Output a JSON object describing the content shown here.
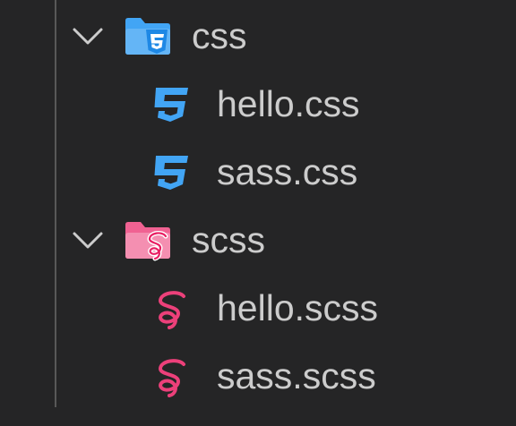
{
  "explorer": {
    "folders": [
      {
        "name": "css",
        "expanded": true,
        "icon": "css-folder-icon",
        "icon_color": "#42a5f5",
        "files": [
          {
            "name": "hello.css",
            "icon": "css3-icon",
            "icon_color": "#42a5f5"
          },
          {
            "name": "sass.css",
            "icon": "css3-icon",
            "icon_color": "#42a5f5"
          }
        ]
      },
      {
        "name": "scss",
        "expanded": true,
        "icon": "sass-folder-icon",
        "icon_color": "#f06292",
        "files": [
          {
            "name": "hello.scss",
            "icon": "sass-icon",
            "icon_color": "#ec407a"
          },
          {
            "name": "sass.scss",
            "icon": "sass-icon",
            "icon_color": "#ec407a"
          }
        ]
      }
    ]
  },
  "colors": {
    "background": "#252526",
    "text": "#cccccc",
    "indent_guide": "#585858",
    "chevron": "#cccccc"
  }
}
